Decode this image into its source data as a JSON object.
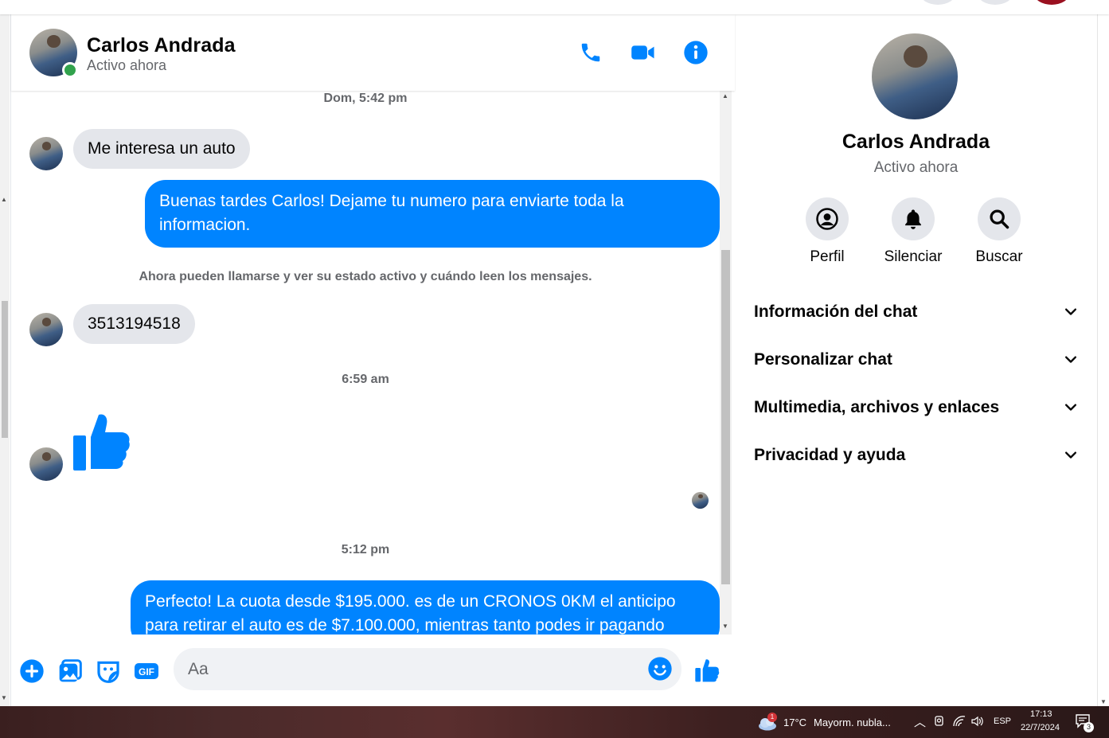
{
  "colors": {
    "accent": "#0084ff",
    "online": "#31a24c",
    "incoming_bubble": "#e4e6eb"
  },
  "header": {
    "name": "Carlos Andrada",
    "status": "Activo ahora",
    "icons": [
      "phone-icon",
      "video-camera-icon",
      "info-icon"
    ]
  },
  "messages": {
    "ts1": "Dom, 5:42 pm",
    "in1": "Me interesa un auto",
    "out1": "Buenas tardes Carlos! Dejame tu numero para enviarte toda la informacion.",
    "notice": "Ahora pueden llamarse y ver su estado activo y cuándo leen los mensajes.",
    "in2": "3513194518",
    "ts2": "6:59 am",
    "ts3": "5:12 pm",
    "out2": "Perfecto! La cuota desde $195.000. es de un CRONOS 0KM el anticipo para retirar el auto es de $7.100.000, mientras tanto podes ir pagando"
  },
  "composer": {
    "placeholder": "Aa",
    "icons": [
      "plus-circle-icon",
      "image-icon",
      "sticker-icon",
      "gif-icon",
      "emoji-icon",
      "like-icon"
    ]
  },
  "sidebar": {
    "name": "Carlos Andrada",
    "status": "Activo ahora",
    "actions": [
      {
        "label": "Perfil",
        "icon": "profile-icon"
      },
      {
        "label": "Silenciar",
        "icon": "bell-icon"
      },
      {
        "label": "Buscar",
        "icon": "search-icon"
      }
    ],
    "sections": [
      {
        "title": "Información del chat"
      },
      {
        "title": "Personalizar chat"
      },
      {
        "title": "Multimedia, archivos y enlaces"
      },
      {
        "title": "Privacidad y ayuda"
      }
    ]
  },
  "taskbar": {
    "weather_badge": "1",
    "temperature": "17°C",
    "weather_text": "Mayorm. nubla...",
    "language": "ESP",
    "time": "17:13",
    "date": "22/7/2024",
    "notifications": "3"
  }
}
